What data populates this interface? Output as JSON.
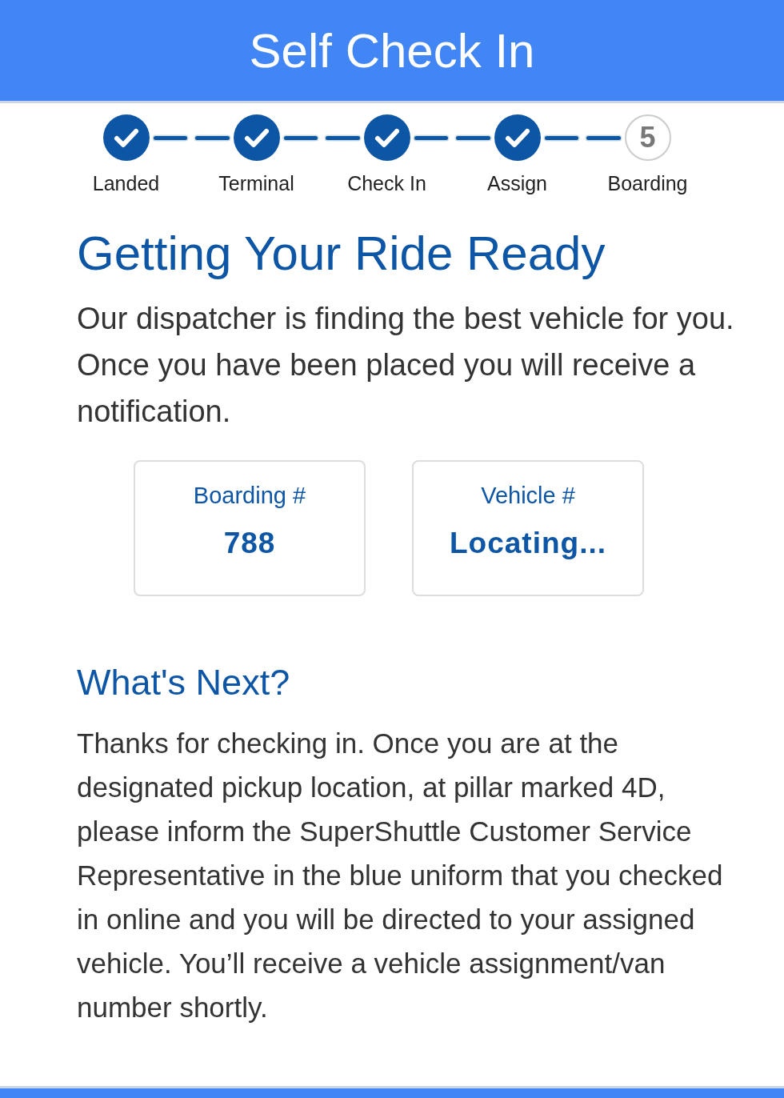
{
  "header": {
    "title": "Self Check In"
  },
  "steps": [
    {
      "label": "Landed",
      "done": true
    },
    {
      "label": "Terminal",
      "done": true
    },
    {
      "label": "Check In",
      "done": true
    },
    {
      "label": "Assign",
      "done": true
    },
    {
      "label": "Boarding",
      "done": false,
      "number": "5"
    }
  ],
  "heading": "Getting Your Ride Ready",
  "intro": "Our dispatcher is finding the best vehicle for you. Once you have been placed you will receive a notification.",
  "cards": [
    {
      "label": "Boarding #",
      "value": "788"
    },
    {
      "label": "Vehicle #",
      "value": "Locating..."
    }
  ],
  "next": {
    "title": "What's Next?",
    "text": "Thanks for checking in. Once you are at the designated pickup location, at pillar marked 4D, please inform the SuperShuttle Customer Service Representative in the blue uniform that you checked in online and you will be directed to your assigned vehicle. You’ll receive a vehicle assignment/van number shortly."
  }
}
